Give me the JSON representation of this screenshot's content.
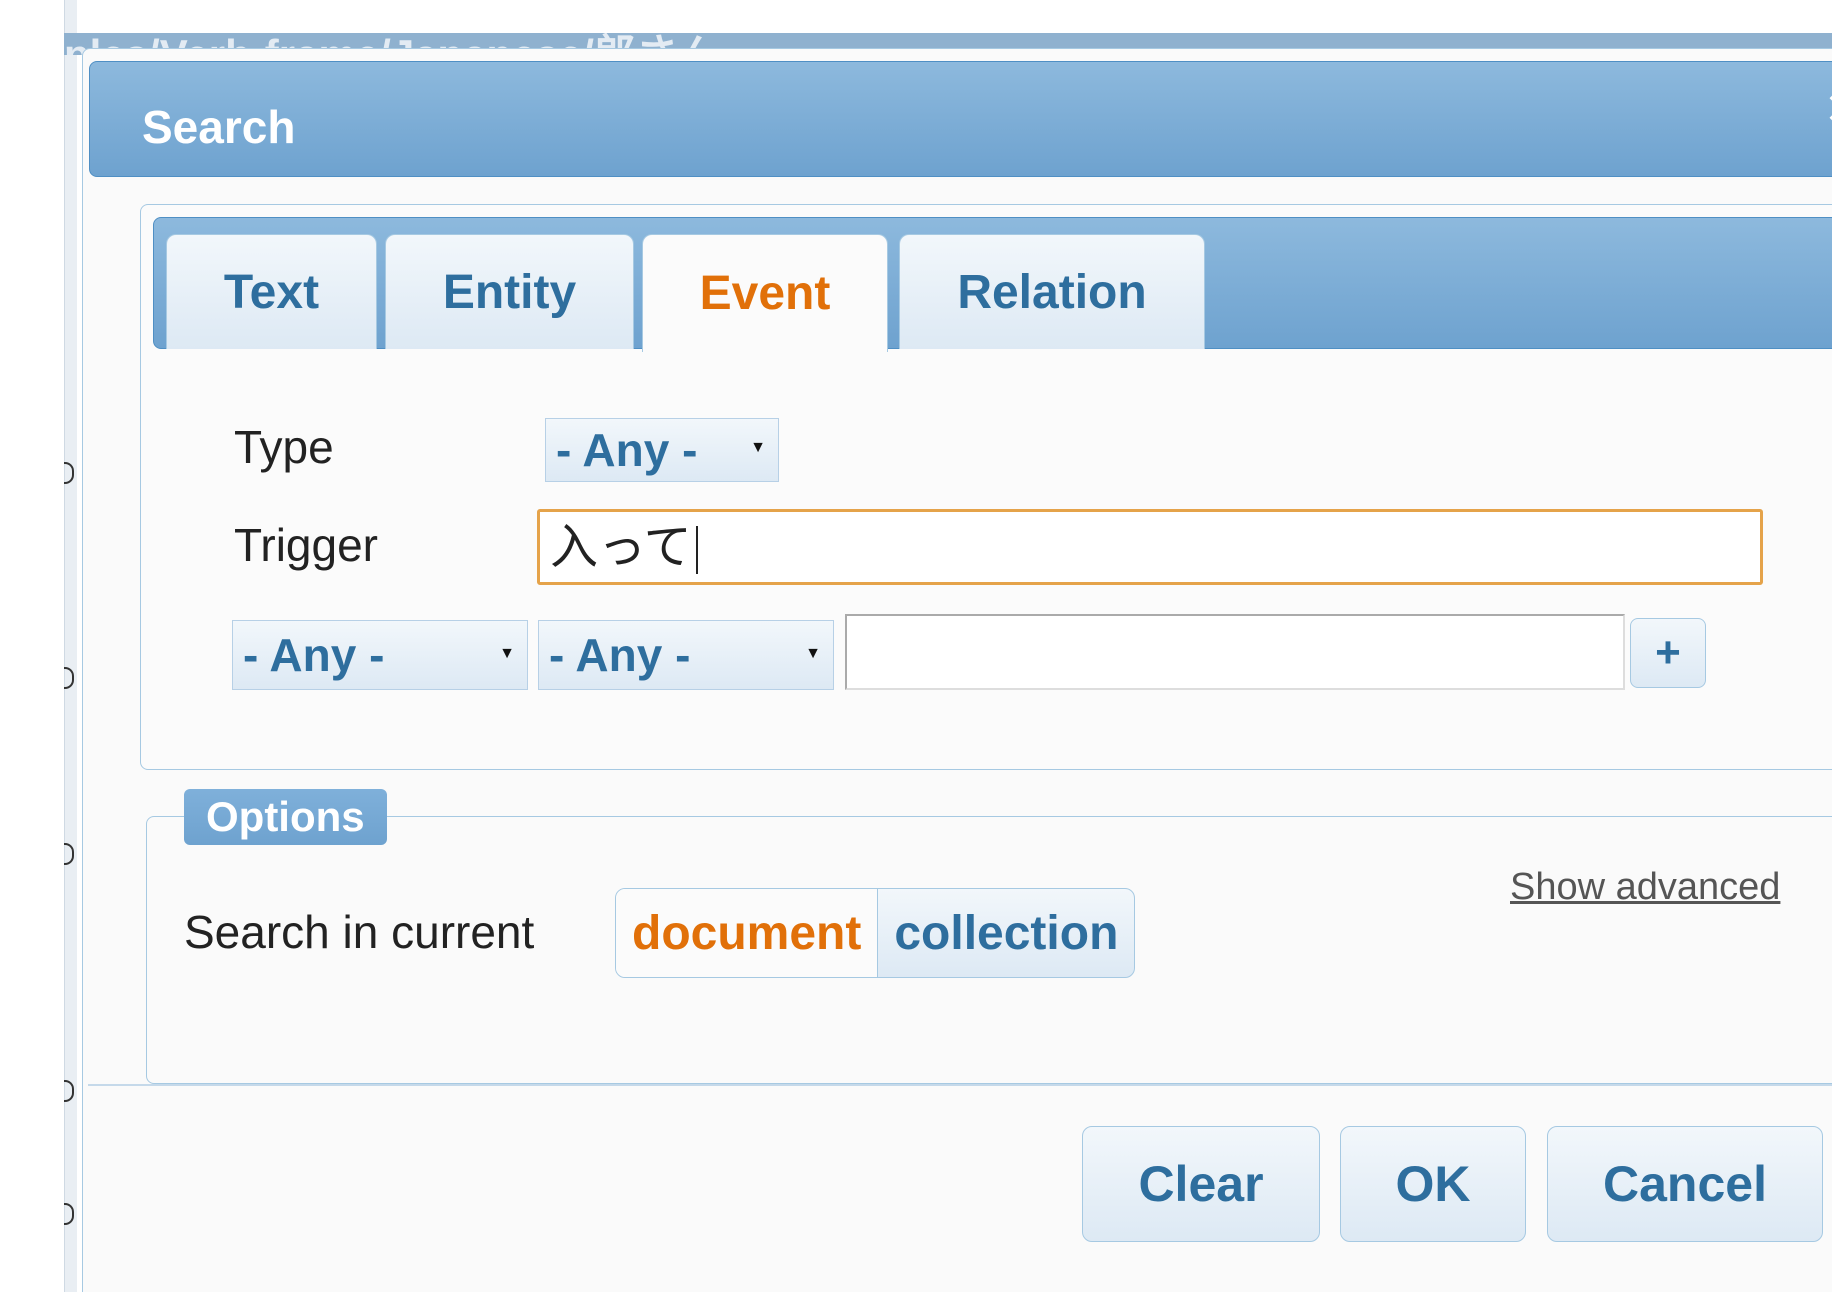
{
  "background": {
    "path_text": "ples/Verb-frame/Japanese/郎さん"
  },
  "dialog": {
    "title": "Search",
    "close_icon": "close-icon"
  },
  "tabs": [
    {
      "label": "Text",
      "active": false
    },
    {
      "label": "Entity",
      "active": false
    },
    {
      "label": "Event",
      "active": true
    },
    {
      "label": "Relation",
      "active": false
    }
  ],
  "event_form": {
    "type_label": "Type",
    "type_value": "- Any -",
    "trigger_label": "Trigger",
    "trigger_value": "入って",
    "arg_role_value": "- Any -",
    "arg_type_value": "- Any -",
    "arg_text_value": "",
    "add_label": "+"
  },
  "options": {
    "legend": "Options",
    "show_advanced": "Show advanced",
    "scope_label": "Search in current",
    "scope_options": [
      {
        "label": "document",
        "selected": true
      },
      {
        "label": "collection",
        "selected": false
      }
    ]
  },
  "buttons": {
    "clear": "Clear",
    "ok": "OK",
    "cancel": "Cancel"
  },
  "colors": {
    "accent": "#e17009",
    "link_blue": "#2e6e9e",
    "header_blue": "#6ea2cf",
    "focus_border": "#e5a34a"
  }
}
